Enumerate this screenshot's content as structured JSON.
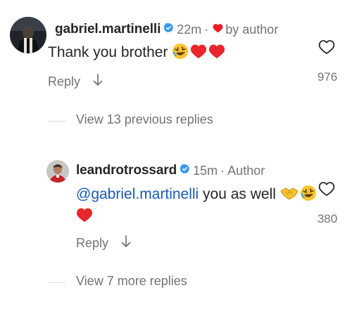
{
  "comments": [
    {
      "username": "gabriel.martinelli",
      "time": "22m",
      "separator": "·",
      "meta_label": "by author",
      "text": "Thank you brother",
      "emoji": [
        "rofl-emoji",
        "red-heart-emoji",
        "red-heart-emoji"
      ],
      "reply_label": "Reply",
      "like_count": "976"
    },
    {
      "username": "leandrotrossard",
      "time": "15m",
      "separator": "·",
      "meta_label": "Author",
      "mention": "@gabriel.martinelli",
      "text": " you as well",
      "emoji": [
        "handshake-emoji",
        "rofl-emoji",
        "red-heart-emoji"
      ],
      "reply_label": "Reply",
      "like_count": "380"
    }
  ],
  "threads": {
    "previous_replies": "View 13 previous replies",
    "more_replies": "View 7 more replies"
  },
  "colors": {
    "text": "#262626",
    "secondary": "#737373",
    "mention": "#1a5ab8",
    "verified": "#3897f0",
    "heart": "#ed1c24"
  }
}
